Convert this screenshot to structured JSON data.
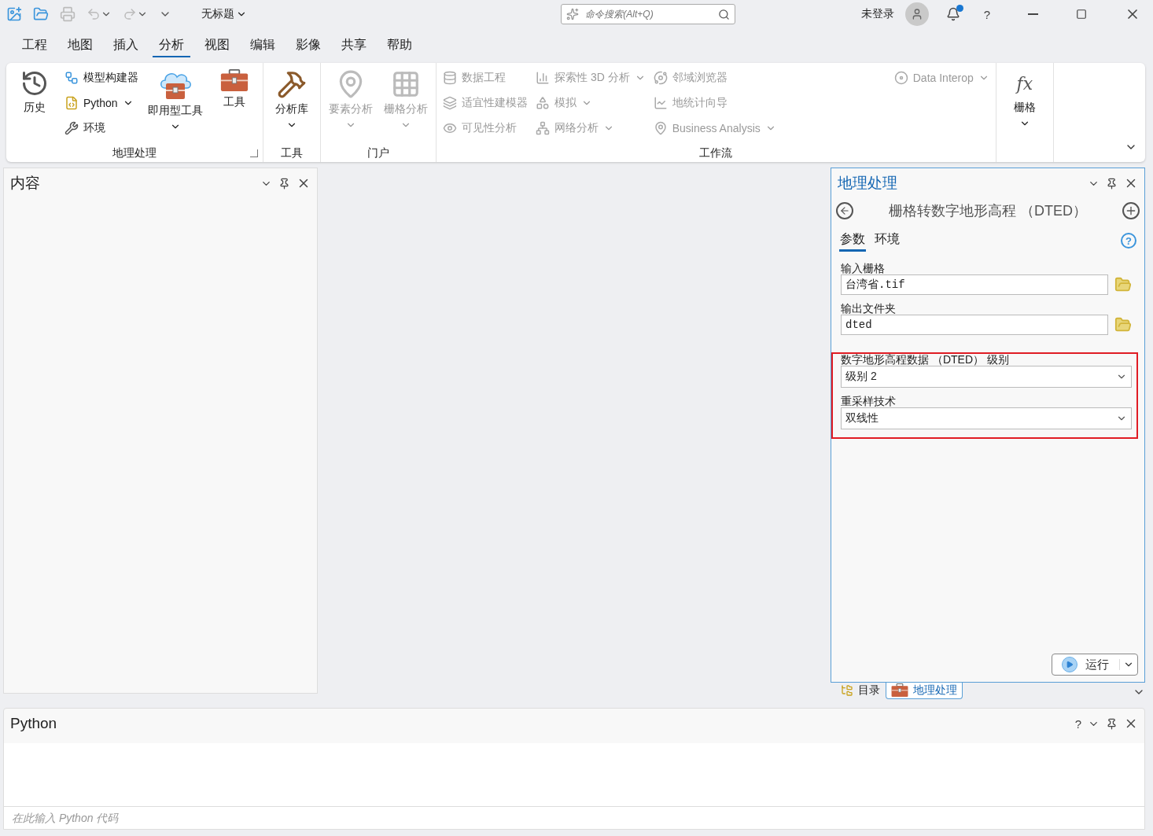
{
  "titlebar": {
    "title": "无标题",
    "search": {
      "placeholder": "命令搜索(Alt+Q)"
    },
    "user": "未登录",
    "notification": true,
    "help": "?"
  },
  "menu": [
    {
      "label": "工程",
      "selected": false
    },
    {
      "label": "地图",
      "selected": false
    },
    {
      "label": "插入",
      "selected": false
    },
    {
      "label": "分析",
      "selected": true
    },
    {
      "label": "视图",
      "selected": false
    },
    {
      "label": "编辑",
      "selected": false
    },
    {
      "label": "影像",
      "selected": false
    },
    {
      "label": "共享",
      "selected": false
    },
    {
      "label": "帮助",
      "selected": false
    }
  ],
  "ribbon": {
    "groups": [
      {
        "label": "地理处理",
        "launcher": true,
        "columns": [
          [
            {
              "label": "历史",
              "kind": "large",
              "dropdown": false,
              "disabled": false
            }
          ],
          [
            {
              "label": "模型构建器",
              "kind": "small",
              "dropdown": false,
              "disabled": false
            },
            {
              "label": "Python",
              "kind": "small",
              "dropdown": true,
              "disabled": false
            },
            {
              "label": "环境",
              "kind": "small",
              "dropdown": false,
              "disabled": false
            }
          ],
          [
            {
              "label": "即用型工具",
              "kind": "large",
              "dropdown": true,
              "disabled": false
            }
          ],
          [
            {
              "label": "工具",
              "kind": "large",
              "dropdown": false,
              "disabled": false
            }
          ]
        ]
      },
      {
        "label": "工具",
        "launcher": false,
        "columns": [
          [
            {
              "label": "分析库",
              "kind": "large",
              "dropdown": true,
              "disabled": false
            }
          ]
        ]
      },
      {
        "label": "门户",
        "launcher": false,
        "columns": [
          [
            {
              "label": "要素分析",
              "kind": "large",
              "dropdown": true,
              "disabled": true
            }
          ],
          [
            {
              "label": "栅格分析",
              "kind": "large",
              "dropdown": true,
              "disabled": true
            }
          ]
        ]
      },
      {
        "label": "工作流",
        "launcher": false,
        "columns": [
          [
            {
              "label": "数据工程",
              "kind": "small",
              "dropdown": false,
              "disabled": true
            },
            {
              "label": "适宜性建模器",
              "kind": "small",
              "dropdown": false,
              "disabled": true
            },
            {
              "label": "可见性分析",
              "kind": "small",
              "dropdown": false,
              "disabled": true
            }
          ],
          [
            {
              "label": "探索性 3D 分析",
              "kind": "small",
              "dropdown": true,
              "disabled": true
            },
            {
              "label": "模拟",
              "kind": "small",
              "dropdown": true,
              "disabled": true
            },
            {
              "label": "网络分析",
              "kind": "small",
              "dropdown": true,
              "disabled": true
            }
          ],
          [
            {
              "label": "邻域浏览器",
              "kind": "small",
              "dropdown": false,
              "disabled": true
            },
            {
              "label": "地统计向导",
              "kind": "small",
              "dropdown": false,
              "disabled": true
            },
            {
              "label": "Business Analysis",
              "kind": "small",
              "dropdown": true,
              "disabled": true
            }
          ],
          [
            {
              "label": "Data Interop",
              "kind": "small",
              "dropdown": true,
              "disabled": true
            }
          ]
        ]
      },
      {
        "launcher": false,
        "columns": [
          [
            {
              "label": "栅格",
              "kind": "large",
              "symbol": "fx",
              "dropdown": true,
              "disabled": false
            }
          ]
        ]
      }
    ]
  },
  "contents": {
    "title": "内容"
  },
  "geoprocessing": {
    "title": "地理处理",
    "tool": "栅格转数字地形高程 （DTED）",
    "tabs": [
      {
        "label": "参数",
        "selected": true
      },
      {
        "label": "环境",
        "selected": false
      }
    ],
    "parameters": [
      {
        "label": "输入栅格",
        "kind": "text",
        "value": "台湾省.tif",
        "highlighted": false
      },
      {
        "label": "输出文件夹",
        "kind": "text",
        "value": "dted",
        "highlighted": false
      },
      {
        "label": "数字地形高程数据 （DTED） 级别",
        "kind": "select",
        "value": "级别 2",
        "highlighted": true
      },
      {
        "label": "重采样技术",
        "kind": "select",
        "value": "双线性",
        "highlighted": true
      }
    ],
    "help": "?",
    "run": "运行"
  },
  "dock_tabs": [
    {
      "label": "目录",
      "selected": false
    },
    {
      "label": "地理处理",
      "selected": true
    }
  ],
  "python": {
    "title": "Python",
    "placeholder": "在此输入 Python 代码",
    "help": "?"
  }
}
